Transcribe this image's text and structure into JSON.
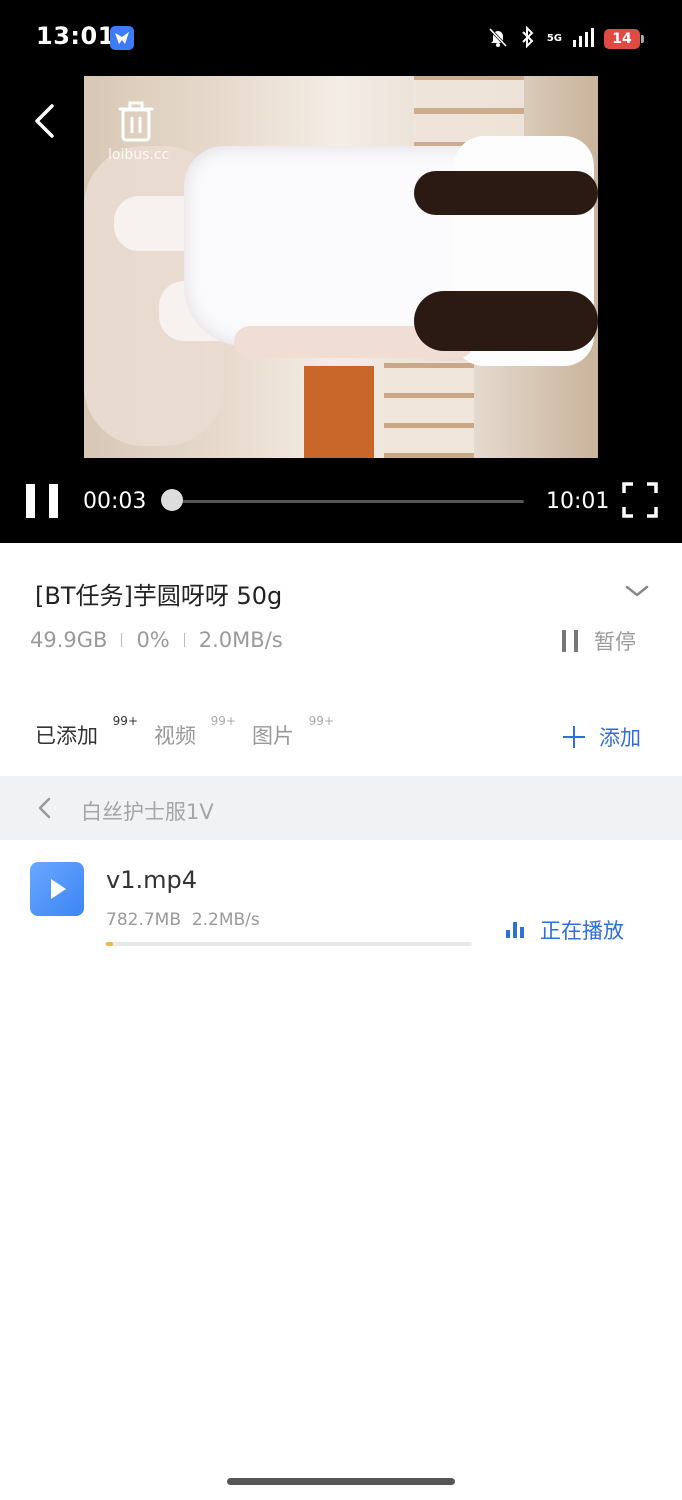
{
  "status_bar": {
    "time": "13:01",
    "network": "5G",
    "battery": "14"
  },
  "player": {
    "watermark": "loibus.cc",
    "current_time": "00:03",
    "total_time": "10:01",
    "progress": 0.005
  },
  "task": {
    "title": "[BT任务]芋圆呀呀 50g",
    "size": "49.9GB",
    "percent": "0%",
    "speed": "2.0MB/s",
    "pause_label": "暂停"
  },
  "tabs": [
    {
      "label": "已添加",
      "badge": "99+"
    },
    {
      "label": "视频",
      "badge": "99+"
    },
    {
      "label": "图片",
      "badge": "99+"
    }
  ],
  "add_label": "添加",
  "folder": {
    "name": "白丝护士服1V"
  },
  "files": [
    {
      "name": "v1.mp4",
      "size": "782.7MB",
      "speed": "2.2MB/s",
      "status": "正在播放",
      "progress": 0.02
    }
  ],
  "colors": {
    "accent": "#2f6fd9",
    "progress": "#f2b83c",
    "battery": "#e04a44"
  }
}
